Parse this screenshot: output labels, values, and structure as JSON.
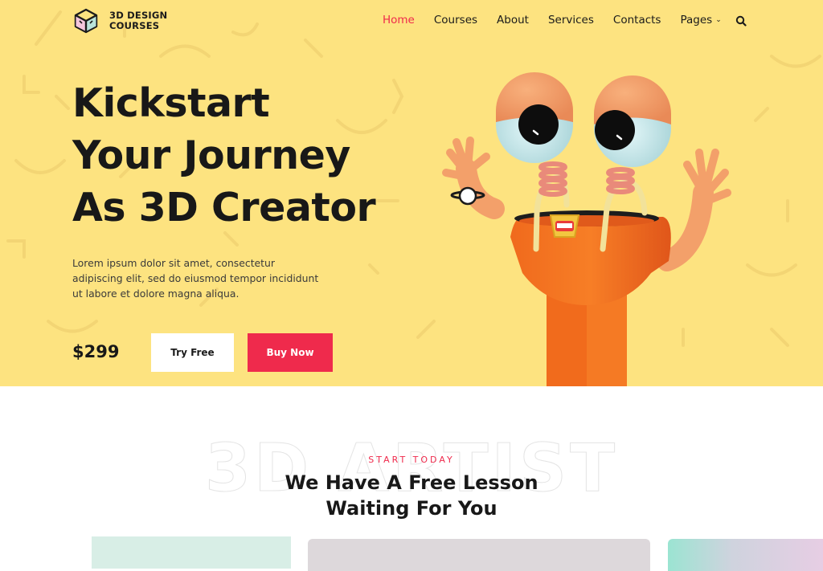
{
  "brand": {
    "name_line1": "3D DESIGN",
    "name_line2": "COURSES",
    "icon": "cube-icon"
  },
  "nav": {
    "items": [
      {
        "label": "Home",
        "active": true
      },
      {
        "label": "Courses",
        "active": false
      },
      {
        "label": "About",
        "active": false
      },
      {
        "label": "Services",
        "active": false
      },
      {
        "label": "Contacts",
        "active": false
      },
      {
        "label": "Pages",
        "active": false,
        "has_dropdown": true
      }
    ],
    "search_icon": "search-icon",
    "dropdown_icon": "chevron-down-icon"
  },
  "hero": {
    "headline_lines": [
      "Kickstart",
      "Your Journey",
      "As 3D Creator"
    ],
    "description": "Lorem ipsum dolor sit amet, consectetur adipiscing elit, sed do eiusmod tempor incididunt ut labore et dolore magna aliqua.",
    "price": "$299",
    "try_label": "Try Free",
    "buy_label": "Buy Now",
    "illustration": "3d-character-illustration"
  },
  "lesson_section": {
    "outline_text": "3D ARTIST",
    "eyebrow": "START TODAY",
    "title_line1": "We Have A Free Lesson",
    "title_line2": "Waiting For You"
  },
  "colors": {
    "hero_bg": "#fde380",
    "accent": "#ef2a4c",
    "text": "#181818"
  }
}
